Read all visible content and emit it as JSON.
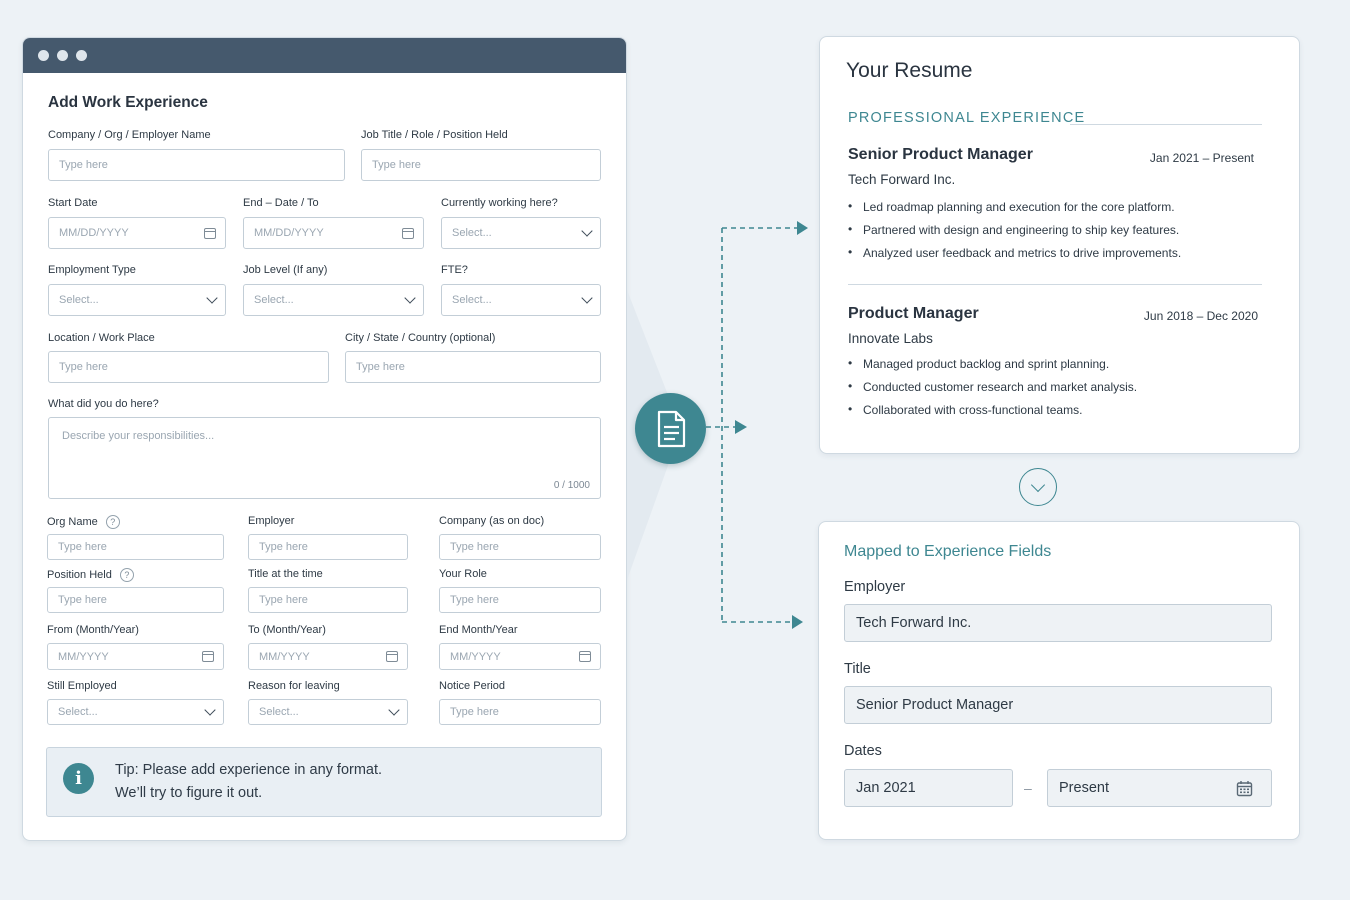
{
  "form": {
    "title": "Add Work Experience",
    "company_label": "Company / Org / Employer Name",
    "company_placeholder": "Type here",
    "job_title_label": "Job Title / Role / Position Held",
    "job_title_placeholder": "Type here",
    "start_date_label": "Start Date",
    "start_date_placeholder": "MM/DD/YYYY",
    "end_date_label": "End – Date / To",
    "end_date_placeholder": "MM/DD/YYYY",
    "currently_working_label": "Currently working here?",
    "currently_working_value": "Select...",
    "employment_type_label": "Employment Type",
    "employment_type_value": "Select...",
    "job_level_label": "Job Level (If any)",
    "job_level_value": "Select...",
    "fte_label": "FTE?",
    "fte_value": "Select...",
    "location_label": "Location / Work Place",
    "location_placeholder": "Type here",
    "city_label": "City / State / Country (optional)",
    "city_placeholder": "Type here",
    "description_label": "What did you do here?",
    "description_placeholder": "Describe your responsibilities...",
    "char_count": "0 / 1000",
    "org_name_label": "Org Name",
    "org_name_placeholder": "Type here",
    "employer_label": "Employer",
    "employer_placeholder": "Type here",
    "company_doc_label": "Company (as on doc)",
    "company_doc_placeholder": "Type here",
    "position_held_label": "Position Held",
    "position_held_placeholder": "Type here",
    "title_at_time_label": "Title at the time",
    "title_at_time_placeholder": "Type here",
    "your_role_label": "Your Role",
    "your_role_placeholder": "Type here",
    "from_label": "From (Month/Year)",
    "from_placeholder": "MM/YYYY",
    "to_label": "To (Month/Year)",
    "to_placeholder": "MM/YYYY",
    "end_month_label": "End Month/Year",
    "end_month_placeholder": "MM/YYYY",
    "still_employed_label": "Still Employed",
    "still_employed_value": "Select...",
    "reason_label": "Reason for leaving",
    "reason_value": "Select...",
    "notice_label": "Notice Period",
    "notice_placeholder": "Type here",
    "help_glyph": "?",
    "tip_line1": "Tip: Please add experience in any format.",
    "tip_line2": "We’ll try to figure it out.",
    "info_glyph": "i"
  },
  "resume": {
    "title": "Your Resume",
    "section": "PROFESSIONAL EXPERIENCE",
    "jobs": [
      {
        "title": "Senior Product Manager",
        "dates": "Jan 2021 – Present",
        "company": "Tech Forward Inc.",
        "bullets": [
          "Led roadmap planning and execution for the core platform.",
          "Partnered with design and engineering to ship key features.",
          "Analyzed user feedback and metrics to drive improvements."
        ]
      },
      {
        "title": "Product Manager",
        "dates": "Jun 2018 – Dec 2020",
        "company": "Innovate Labs",
        "bullets": [
          "Managed product backlog and sprint planning.",
          "Conducted customer research and market analysis.",
          "Collaborated with cross-functional teams."
        ]
      }
    ]
  },
  "mapped": {
    "title": "Mapped to Experience Fields",
    "employer_label": "Employer",
    "employer_value": "Tech Forward Inc.",
    "title_label": "Title",
    "title_value": "Senior Product Manager",
    "dates_label": "Dates",
    "start_value": "Jan 2021",
    "dash": "–",
    "end_value": "Present"
  },
  "colors": {
    "accent": "#3e8791",
    "titlebar": "#45596d",
    "background": "#edf2f6"
  },
  "icons": [
    "document-icon",
    "calendar-icon",
    "chevron-down-icon",
    "info-icon",
    "help-icon",
    "arrow-right-icon"
  ]
}
